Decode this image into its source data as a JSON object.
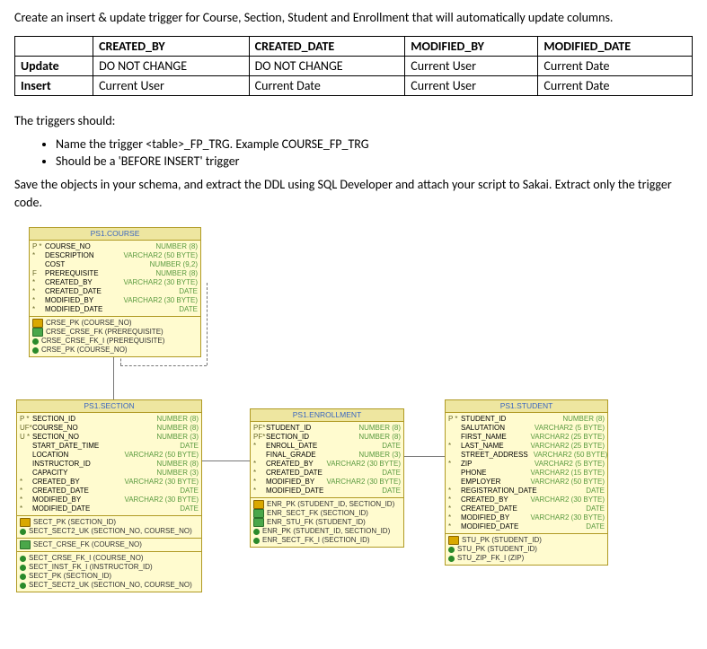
{
  "intro": "Create an insert & update trigger for Course, Section, Student and Enrollment that will automatically update columns.",
  "table": {
    "headers": [
      "",
      "CREATED_BY",
      "CREATED_DATE",
      "MODIFIED_BY",
      "MODIFIED_DATE"
    ],
    "rows": [
      {
        "label": "Update",
        "cells": [
          "DO NOT CHANGE",
          "DO NOT CHANGE",
          "Current User",
          "Current Date"
        ]
      },
      {
        "label": "Insert",
        "cells": [
          "Current User",
          "Current Date",
          "Current User",
          "Current Date"
        ]
      }
    ]
  },
  "triggers_heading": "The triggers should:",
  "bullets": [
    "Name the trigger <table>_FP_TRG.  Example COURSE_FP_TRG",
    "Should be a 'BEFORE INSERT' trigger"
  ],
  "save_text": "Save the objects in your schema, and extract the DDL using SQL Developer and attach your script to Sakai.  Extract only the trigger code.",
  "er": {
    "course": {
      "title": "PS1.COURSE",
      "cols": [
        {
          "m": "P *",
          "n": "COURSE_NO",
          "t": "NUMBER (8)"
        },
        {
          "m": "*",
          "n": "DESCRIPTION",
          "t": "VARCHAR2 (50 BYTE)"
        },
        {
          "m": "",
          "n": "COST",
          "t": "NUMBER (9,2)"
        },
        {
          "m": "F",
          "n": "PREREQUISITE",
          "t": "NUMBER (8)"
        },
        {
          "m": "*",
          "n": "CREATED_BY",
          "t": "VARCHAR2 (30 BYTE)"
        },
        {
          "m": "*",
          "n": "CREATED_DATE",
          "t": "DATE"
        },
        {
          "m": "*",
          "n": "MODIFIED_BY",
          "t": "VARCHAR2 (30 BYTE)"
        },
        {
          "m": "*",
          "n": "MODIFIED_DATE",
          "t": "DATE"
        }
      ],
      "keys": [
        {
          "i": "pk",
          "t": "CRSE_PK (COURSE_NO)"
        },
        {
          "i": "uk",
          "t": "CRSE_CRSE_FK (PREREQUISITE)"
        },
        {
          "i": "fk",
          "t": "CRSE_CRSE_FK_I (PREREQUISITE)"
        },
        {
          "i": "fk",
          "t": "CRSE_PK (COURSE_NO)"
        }
      ]
    },
    "section": {
      "title": "PS1.SECTION",
      "cols": [
        {
          "m": "P *",
          "n": "SECTION_ID",
          "t": "NUMBER (8)"
        },
        {
          "m": "UF*",
          "n": "COURSE_NO",
          "t": "NUMBER (8)"
        },
        {
          "m": "U *",
          "n": "SECTION_NO",
          "t": "NUMBER (3)"
        },
        {
          "m": "",
          "n": "START_DATE_TIME",
          "t": "DATE"
        },
        {
          "m": "",
          "n": "LOCATION",
          "t": "VARCHAR2 (50 BYTE)"
        },
        {
          "m": "",
          "n": "INSTRUCTOR_ID",
          "t": "NUMBER (8)"
        },
        {
          "m": "",
          "n": "CAPACITY",
          "t": "NUMBER (3)"
        },
        {
          "m": "*",
          "n": "CREATED_BY",
          "t": "VARCHAR2 (30 BYTE)"
        },
        {
          "m": "*",
          "n": "CREATED_DATE",
          "t": "DATE"
        },
        {
          "m": "*",
          "n": "MODIFIED_BY",
          "t": "VARCHAR2 (30 BYTE)"
        },
        {
          "m": "*",
          "n": "MODIFIED_DATE",
          "t": "DATE"
        }
      ],
      "keys1": [
        {
          "i": "pk",
          "t": "SECT_PK (SECTION_ID)"
        },
        {
          "i": "fk",
          "t": "SECT_SECT2_UK (SECTION_NO, COURSE_NO)"
        }
      ],
      "keys2": [
        {
          "i": "uk",
          "t": "SECT_CRSE_FK (COURSE_NO)"
        }
      ],
      "keys3": [
        {
          "i": "fk",
          "t": "SECT_CRSE_FK_I (COURSE_NO)"
        },
        {
          "i": "fk",
          "t": "SECT_INST_FK_I (INSTRUCTOR_ID)"
        },
        {
          "i": "fk",
          "t": "SECT_PK (SECTION_ID)"
        },
        {
          "i": "fk",
          "t": "SECT_SECT2_UK (SECTION_NO, COURSE_NO)"
        }
      ]
    },
    "enrollment": {
      "title": "PS1.ENROLLMENT",
      "cols": [
        {
          "m": "PF*",
          "n": "STUDENT_ID",
          "t": "NUMBER (8)"
        },
        {
          "m": "PF*",
          "n": "SECTION_ID",
          "t": "NUMBER (8)"
        },
        {
          "m": "*",
          "n": "ENROLL_DATE",
          "t": "DATE"
        },
        {
          "m": "",
          "n": "FINAL_GRADE",
          "t": "NUMBER (3)"
        },
        {
          "m": "*",
          "n": "CREATED_BY",
          "t": "VARCHAR2 (30 BYTE)"
        },
        {
          "m": "*",
          "n": "CREATED_DATE",
          "t": "DATE"
        },
        {
          "m": "*",
          "n": "MODIFIED_BY",
          "t": "VARCHAR2 (30 BYTE)"
        },
        {
          "m": "*",
          "n": "MODIFIED_DATE",
          "t": "DATE"
        }
      ],
      "keys": [
        {
          "i": "pk",
          "t": "ENR_PK (STUDENT_ID, SECTION_ID)"
        },
        {
          "i": "uk",
          "t": "ENR_SECT_FK (SECTION_ID)"
        },
        {
          "i": "uk",
          "t": "ENR_STU_FK (STUDENT_ID)"
        },
        {
          "i": "fk",
          "t": "ENR_PK (STUDENT_ID, SECTION_ID)"
        },
        {
          "i": "fk",
          "t": "ENR_SECT_FK_I (SECTION_ID)"
        }
      ]
    },
    "student": {
      "title": "PS1.STUDENT",
      "cols": [
        {
          "m": "P *",
          "n": "STUDENT_ID",
          "t": "NUMBER (8)"
        },
        {
          "m": "",
          "n": "SALUTATION",
          "t": "VARCHAR2 (5 BYTE)"
        },
        {
          "m": "",
          "n": "FIRST_NAME",
          "t": "VARCHAR2 (25 BYTE)"
        },
        {
          "m": "*",
          "n": "LAST_NAME",
          "t": "VARCHAR2 (25 BYTE)"
        },
        {
          "m": "",
          "n": "STREET_ADDRESS",
          "t": "VARCHAR2 (50 BYTE)"
        },
        {
          "m": "*",
          "n": "ZIP",
          "t": "VARCHAR2 (5 BYTE)"
        },
        {
          "m": "",
          "n": "PHONE",
          "t": "VARCHAR2 (15 BYTE)"
        },
        {
          "m": "",
          "n": "EMPLOYER",
          "t": "VARCHAR2 (50 BYTE)"
        },
        {
          "m": "*",
          "n": "REGISTRATION_DATE",
          "t": "DATE"
        },
        {
          "m": "*",
          "n": "CREATED_BY",
          "t": "VARCHAR2 (30 BYTE)"
        },
        {
          "m": "*",
          "n": "CREATED_DATE",
          "t": "DATE"
        },
        {
          "m": "*",
          "n": "MODIFIED_BY",
          "t": "VARCHAR2 (30 BYTE)"
        },
        {
          "m": "*",
          "n": "MODIFIED_DATE",
          "t": "DATE"
        }
      ],
      "keys": [
        {
          "i": "pk",
          "t": "STU_PK (STUDENT_ID)"
        },
        {
          "i": "fk",
          "t": "STU_PK (STUDENT_ID)"
        },
        {
          "i": "fk",
          "t": "STU_ZIP_FK_I (ZIP)"
        }
      ]
    }
  }
}
